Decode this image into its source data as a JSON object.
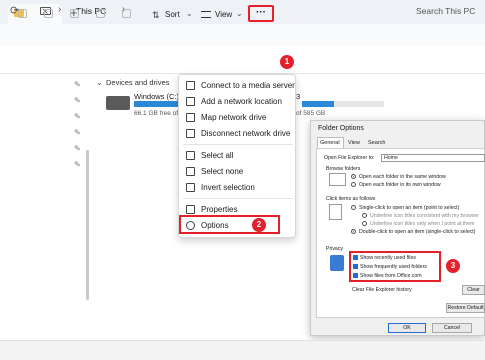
{
  "window": {
    "tab_close": "×",
    "tab_add": "+"
  },
  "address": {
    "path": "This PC",
    "search_placeholder": "Search This PC"
  },
  "toolbar": {
    "sort_label": "Sort",
    "view_label": "View",
    "more_label": "···"
  },
  "steps": {
    "one": "1",
    "two": "2",
    "three": "3"
  },
  "nav": {
    "group_label": "Devices and drives"
  },
  "drives": [
    {
      "name": "Windows (C:)",
      "free_text": "66.1 GB free of",
      "usage": 0.5
    },
    {
      "name": "3",
      "free_text": "of 585 GB",
      "usage": 0.4
    }
  ],
  "menu": {
    "items": [
      "Connect to a media server",
      "Add a network location",
      "Map network drive",
      "Disconnect network drive",
      "Select all",
      "Select none",
      "Invert selection",
      "Properties",
      "Options"
    ]
  },
  "dialog": {
    "title": "Folder Options",
    "tabs": [
      "General",
      "View",
      "Search"
    ],
    "open_label": "Open File Explorer to:",
    "open_value": "Home",
    "browse_label": "Browse folders",
    "browse_opts": [
      "Open each folder in the same window",
      "Open each folder in its own window"
    ],
    "click_label": "Click items as follows",
    "click_opts": [
      "Single-click to open an item (point to select)",
      "Underline icon titles consistent with my browser",
      "Underline icon titles only when I point at them",
      "Double-click to open an item (single-click to select)"
    ],
    "privacy_label": "Privacy",
    "privacy_opts": [
      "Show recently used files",
      "Show frequently used folders",
      "Show files from Office.com"
    ],
    "clear_label": "Clear File Explorer history",
    "clear_btn": "Clear",
    "restore_btn": "Restore Default",
    "ok_btn": "OK",
    "cancel_btn": "Cancel"
  },
  "colors": {
    "accent": "#2b88d8",
    "highlight": "#e4202b"
  }
}
